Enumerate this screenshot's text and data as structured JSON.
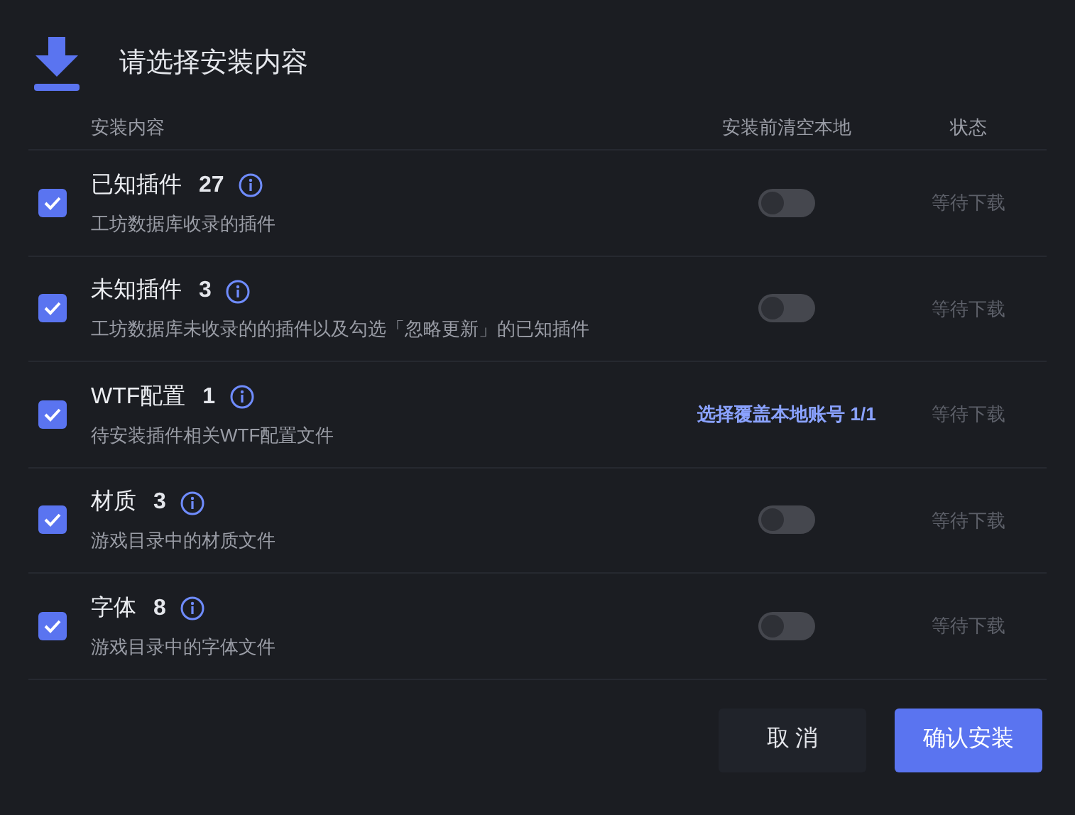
{
  "title": "请选择安装内容",
  "columns": [
    "安装内容",
    "安装前清空本地",
    "状态"
  ],
  "rows": [
    {
      "name": "已知插件",
      "count": "27",
      "description": "工坊数据库收录的插件",
      "checked": true,
      "kind": "toggle",
      "on": false,
      "status": "等待下载"
    },
    {
      "name": "未知插件",
      "count": "3",
      "description": "工坊数据库未收录的的插件以及勾选「忽略更新」的已知插件",
      "checked": true,
      "kind": "toggle",
      "on": false,
      "status": "等待下载"
    },
    {
      "name": "WTF配置",
      "count": "1",
      "description": "待安装插件相关WTF配置文件",
      "checked": true,
      "kind": "link",
      "link": "选择覆盖本地账号 1/1",
      "status": "等待下载"
    },
    {
      "name": "材质",
      "count": "3",
      "description": "游戏目录中的材质文件",
      "checked": true,
      "kind": "toggle",
      "on": false,
      "status": "等待下载"
    },
    {
      "name": "字体",
      "count": "8",
      "description": "游戏目录中的字体文件",
      "checked": true,
      "kind": "toggle",
      "on": false,
      "status": "等待下载"
    }
  ],
  "buttons": [
    {
      "label": "取 消",
      "kind": "secondary"
    },
    {
      "label": "确认安装",
      "kind": "primary"
    }
  ]
}
